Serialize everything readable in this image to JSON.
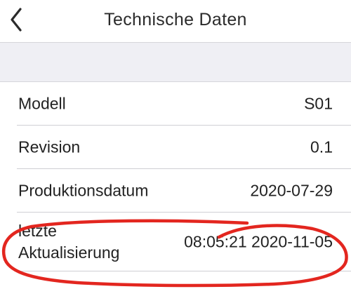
{
  "header": {
    "title": "Technische Daten",
    "back_icon": "chevron-left-icon"
  },
  "rows": [
    {
      "label": "Modell",
      "value": "S01"
    },
    {
      "label": "Revision",
      "value": "0.1"
    },
    {
      "label": "Produktionsdatum",
      "value": "2020-07-29"
    },
    {
      "label_line1": "letzte",
      "label_line2": "Aktualisierung",
      "value": "08:05:21 2020-11-05"
    }
  ],
  "colors": {
    "background": "#ffffff",
    "section_background": "#efeff4",
    "separator": "#cfcfd4",
    "text": "#222222",
    "annotation_marker": "#e3261f"
  },
  "annotation": {
    "shape": "hand-drawn ellipse",
    "target": "rows.3"
  }
}
